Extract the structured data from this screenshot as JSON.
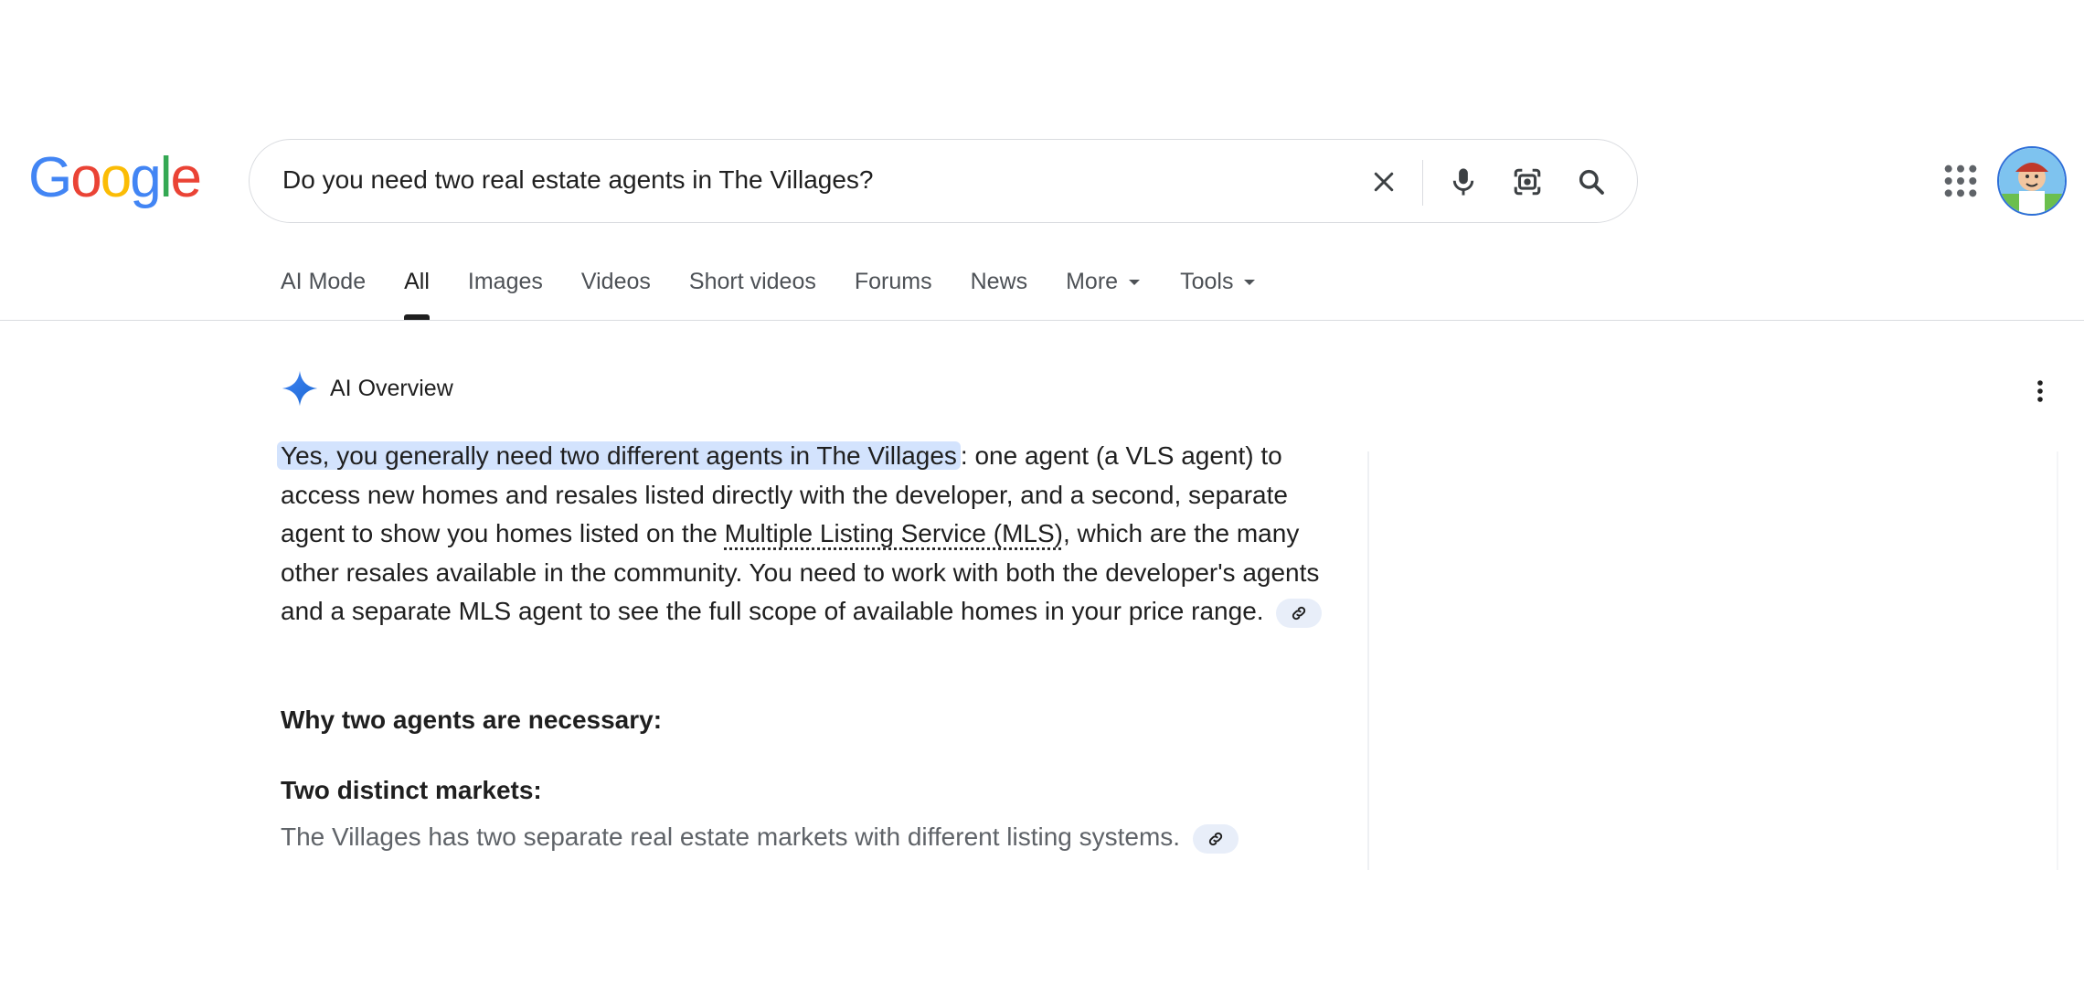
{
  "logo": {
    "letters": [
      "G",
      "o",
      "o",
      "g",
      "l",
      "e"
    ],
    "colors": [
      "#4285F4",
      "#EA4335",
      "#FBBC05",
      "#4285F4",
      "#34A853",
      "#EA4335"
    ]
  },
  "search": {
    "query": "Do you need two real estate agents in The Villages?",
    "icons": [
      "close-icon",
      "mic-icon",
      "lens-icon",
      "search-icon"
    ]
  },
  "header": {
    "apps_icon": "apps-grid-icon",
    "avatar_icon": "avatar"
  },
  "tabs": [
    {
      "label": "AI Mode"
    },
    {
      "label": "All",
      "active": true
    },
    {
      "label": "Images"
    },
    {
      "label": "Videos"
    },
    {
      "label": "Short videos"
    },
    {
      "label": "Forums"
    },
    {
      "label": "News"
    },
    {
      "label": "More",
      "dropdown": true
    },
    {
      "label": "Tools",
      "dropdown": true
    }
  ],
  "ai_overview": {
    "label": "AI Overview",
    "highlight": "Yes, you generally need two different agents in The Villages",
    "text1": ": one agent (a VLS agent) to access new homes and resales listed directly with the developer, and a second, separate agent to show you homes listed on the ",
    "link": "Multiple Listing Service (MLS)",
    "text2": ", which are the many other resales available in the community. You need to work with both the developer's agents and a separate MLS agent to see the full scope of available homes in your price range.",
    "heading": "Why two agents are necessary:",
    "subheading": "Two distinct markets:",
    "detail": "The Villages has two separate real estate markets with different listing systems."
  },
  "accent": "#1a73e8"
}
